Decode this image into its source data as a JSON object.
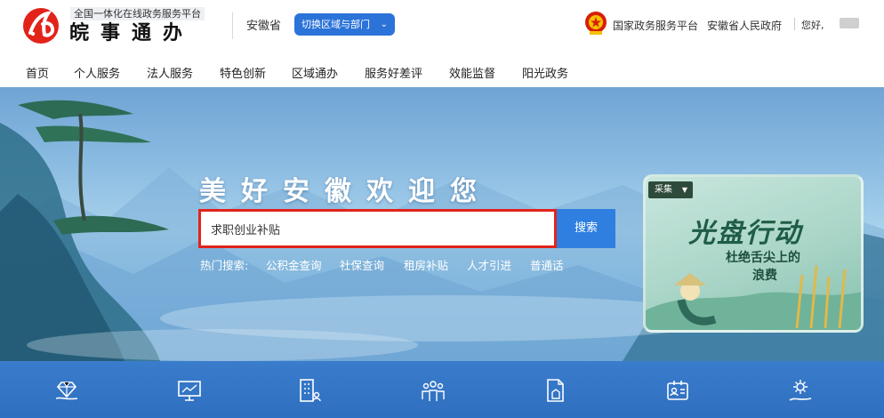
{
  "header": {
    "logo_subtitle": "全国一体化在线政务服务平台",
    "logo_title": "皖事通办",
    "province": "安徽省",
    "switch_label": "切换区域与部门",
    "links": [
      "国家政务服务平台",
      "安徽省人民政府"
    ],
    "greeting": "您好,"
  },
  "nav": {
    "items": [
      "首页",
      "个人服务",
      "法人服务",
      "特色创新",
      "区域通办",
      "服务好差评",
      "效能监督",
      "阳光政务"
    ]
  },
  "hero": {
    "welcome": "美好安徽欢迎您",
    "search_value": "求职创业补贴",
    "search_button": "搜索",
    "hot_label": "热门搜索:",
    "hot_items": [
      "公积金查询",
      "社保查询",
      "租房补贴",
      "人才引进",
      "普通话"
    ]
  },
  "promo": {
    "tag": "采集",
    "title": "光盘行动",
    "line1": "杜绝舌尖上的",
    "line2": "浪费"
  },
  "services": {
    "icons": [
      "diamond-hand-icon",
      "monitor-chart-icon",
      "building-people-icon",
      "people-group-icon",
      "document-building-icon",
      "id-card-icon",
      "gear-hand-icon"
    ]
  },
  "colors": {
    "brand_red": "#e2231a",
    "accent_blue": "#2f7fe0",
    "service_bar": "#3276c6"
  }
}
